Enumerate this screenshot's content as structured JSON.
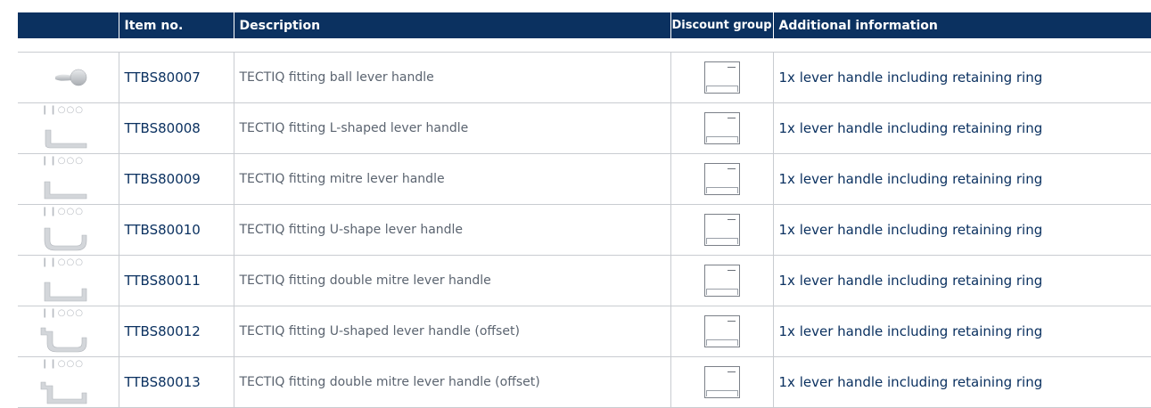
{
  "header": {
    "item_no": "Item no.",
    "description": "Description",
    "discount_group": "Discount group",
    "additional_info": "Additional information"
  },
  "rows": [
    {
      "item": "TTBS80007",
      "desc": "TECTIQ fitting ball lever handle",
      "info": "1x lever handle including retaining ring",
      "icon": "ball-lever-handle-icon",
      "dots": ""
    },
    {
      "item": "TTBS80008",
      "desc": "TECTIQ fitting L-shaped lever handle",
      "info": "1x lever handle including retaining ring",
      "icon": "l-shaped-lever-handle-icon",
      "dots": "❙❙○○○"
    },
    {
      "item": "TTBS80009",
      "desc": "TECTIQ fitting mitre lever handle",
      "info": "1x lever handle including retaining ring",
      "icon": "mitre-lever-handle-icon",
      "dots": "❙❙○○○"
    },
    {
      "item": "TTBS80010",
      "desc": "TECTIQ fitting U-shape lever handle",
      "info": "1x lever handle including retaining ring",
      "icon": "u-shape-lever-handle-icon",
      "dots": "❙❙○○○"
    },
    {
      "item": "TTBS80011",
      "desc": "TECTIQ fitting double mitre lever handle",
      "info": "1x lever handle including retaining ring",
      "icon": "double-mitre-lever-handle-icon",
      "dots": "❙❙○○○"
    },
    {
      "item": "TTBS80012",
      "desc": "TECTIQ fitting U-shaped lever handle (offset)",
      "info": "1x lever handle including retaining ring",
      "icon": "u-shaped-offset-lever-handle-icon",
      "dots": "❙❙○○○"
    },
    {
      "item": "TTBS80013",
      "desc": "TECTIQ fitting double mitre lever handle (offset)",
      "info": "1x lever handle including retaining ring",
      "icon": "double-mitre-offset-lever-handle-icon",
      "dots": "❙❙○○○"
    }
  ],
  "colors": {
    "header_bg": "#0b3160",
    "accent_text": "#0b3160",
    "muted_text": "#5b6470"
  }
}
